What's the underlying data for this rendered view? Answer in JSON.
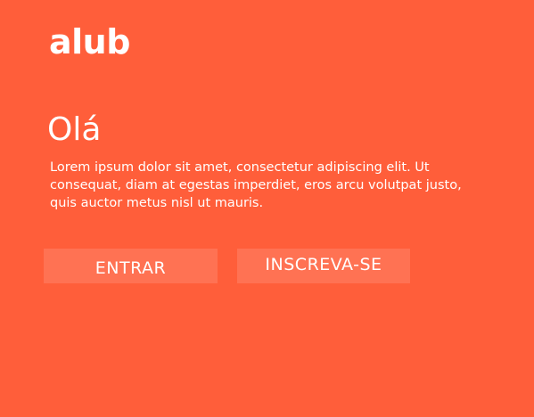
{
  "header": {
    "logo_text": "alub"
  },
  "main": {
    "greeting": "Olá",
    "description": "Lorem ipsum dolor sit amet, consectetur adipiscing elit. Ut consequat, diam at egestas imperdiet, eros arcu volutpat justo, quis auctor metus nisl ut mauris.",
    "buttons": {
      "login_label": "ENTRAR",
      "signup_label": "INSCREVA-SE"
    }
  },
  "colors": {
    "background": "#FF5E3A",
    "text": "#FFFFFF"
  }
}
